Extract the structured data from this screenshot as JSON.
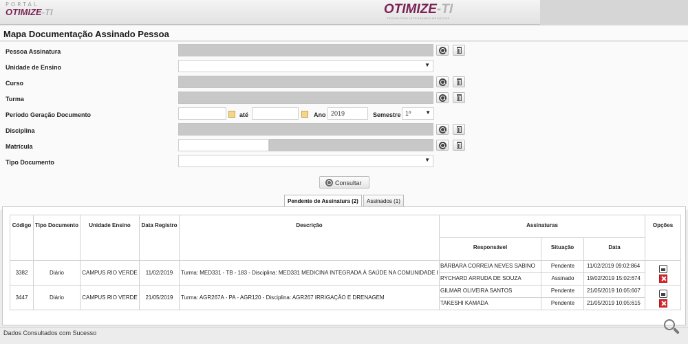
{
  "header": {
    "portal_label": "PORTAL",
    "logo_small_brand": "OTIMIZE",
    "logo_small_ti": "-TI",
    "logo_brand": "OTIMIZE",
    "logo_ti": "-TI",
    "logo_tagline": "TECNOLOGIA INTEGRANDO NEGÓCIOS"
  },
  "page_title": "Mapa Documentação Assinado Pessoa",
  "form": {
    "pessoa_assinatura": "Pessoa Assinatura",
    "unidade_ensino": "Unidade de Ensino",
    "curso": "Curso",
    "turma": "Turma",
    "periodo": "Período Geração Documento",
    "ate": "até",
    "ano_label": "Ano",
    "ano_value": "2019",
    "semestre_label": "Semestre",
    "semestre_value": "1º",
    "disciplina": "Disciplina",
    "matricula": "Matrícula",
    "tipo_documento": "Tipo Documento",
    "consultar": "Consultar"
  },
  "tabs": [
    {
      "label": "Pendente de Assinatura (2)",
      "active": true
    },
    {
      "label": "Assinados (1)",
      "active": false
    }
  ],
  "table": {
    "headers": {
      "codigo": "Código",
      "tipo": "Tipo Documento",
      "unidade": "Unidade Ensino",
      "data_registro": "Data Registro",
      "descricao": "Descrição",
      "assinaturas": "Assinaturas",
      "responsavel": "Responsável",
      "situacao": "Situação",
      "data": "Data",
      "opcoes": "Opções"
    },
    "rows": [
      {
        "codigo": "3382",
        "tipo": "Diário",
        "unidade": "CAMPUS RIO VERDE",
        "data_registro": "11/02/2019",
        "descricao": "Turma: MED331 - TB - 183 - Disciplina: MED331 MEDICINA INTEGRADA À SAÚDE NA COMUNIDADE I",
        "assinaturas": [
          {
            "responsavel": "BÁRBARA CORREIA NEVES SABINO",
            "situacao": "Pendente",
            "data": "11/02/2019 09:02:864"
          },
          {
            "responsavel": "RYCHARD ARRUDA DE SOUZA",
            "situacao": "Assinado",
            "data": "19/02/2019 15:02:674"
          }
        ]
      },
      {
        "codigo": "3447",
        "tipo": "Diário",
        "unidade": "CAMPUS RIO VERDE",
        "data_registro": "21/05/2019",
        "descricao": "Turma: AGR267A - PA - AGR120 - Disciplina: AGR267 IRRIGAÇÃO E DRENAGEM",
        "assinaturas": [
          {
            "responsavel": "GILMAR OLIVEIRA SANTOS",
            "situacao": "Pendente",
            "data": "21/05/2019 10:05:607"
          },
          {
            "responsavel": "TAKESHI KAMADA",
            "situacao": "Pendente",
            "data": "21/05/2019 10:05:615"
          }
        ]
      }
    ]
  },
  "status_text": "Dados Consultados com Sucesso"
}
